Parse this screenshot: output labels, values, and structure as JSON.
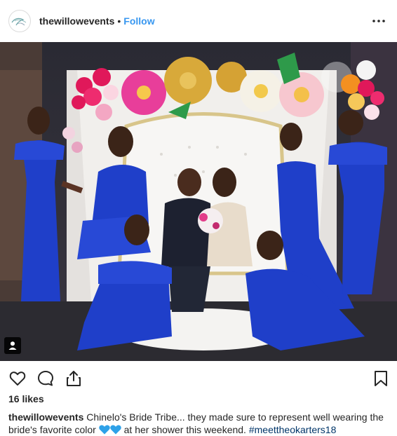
{
  "post": {
    "username": "thewillowevents",
    "separator": "•",
    "follow_label": "Follow",
    "likes": "16 likes",
    "caption_user": "thewillowevents",
    "caption_text_1": " Chinelo's Bride Tribe... they made sure to represent well wearing the bride's favorite color ",
    "caption_text_2": " at her shower this weekend. ",
    "hashtag": "#meettheokarters18"
  },
  "colors": {
    "accent": "#3897f0",
    "dress": "#1f3fc9",
    "text": "#262626",
    "hashtag": "#003569"
  },
  "icons": [
    "more-options-icon",
    "user-tag-icon",
    "heart-icon",
    "comment-icon",
    "share-icon",
    "bookmark-icon",
    "blue-heart-emoji"
  ]
}
